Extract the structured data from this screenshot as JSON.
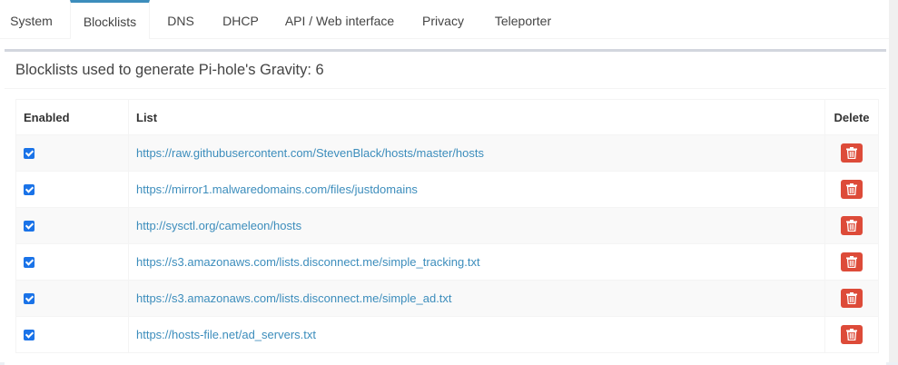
{
  "tabs": [
    {
      "label": "System"
    },
    {
      "label": "Blocklists"
    },
    {
      "label": "DNS"
    },
    {
      "label": "DHCP"
    },
    {
      "label": "API / Web interface"
    },
    {
      "label": "Privacy"
    },
    {
      "label": "Teleporter"
    }
  ],
  "active_tab": "Blocklists",
  "box": {
    "title": "Blocklists used to generate Pi-hole's Gravity: 6"
  },
  "table": {
    "headers": {
      "enabled": "Enabled",
      "list": "List",
      "delete": "Delete"
    },
    "rows": [
      {
        "enabled": true,
        "url": "https://raw.githubusercontent.com/StevenBlack/hosts/master/hosts"
      },
      {
        "enabled": true,
        "url": "https://mirror1.malwaredomains.com/files/justdomains"
      },
      {
        "enabled": true,
        "url": "http://sysctl.org/cameleon/hosts"
      },
      {
        "enabled": true,
        "url": "https://s3.amazonaws.com/lists.disconnect.me/simple_tracking.txt"
      },
      {
        "enabled": true,
        "url": "https://s3.amazonaws.com/lists.disconnect.me/simple_ad.txt"
      },
      {
        "enabled": true,
        "url": "https://hosts-file.net/ad_servers.txt"
      }
    ]
  },
  "icons": {
    "delete": "trash-icon",
    "checkbox": "checkbox-checked"
  },
  "colors": {
    "accent": "#3c8dbc",
    "danger": "#dd4b39",
    "checkbox": "#1a73e8"
  }
}
